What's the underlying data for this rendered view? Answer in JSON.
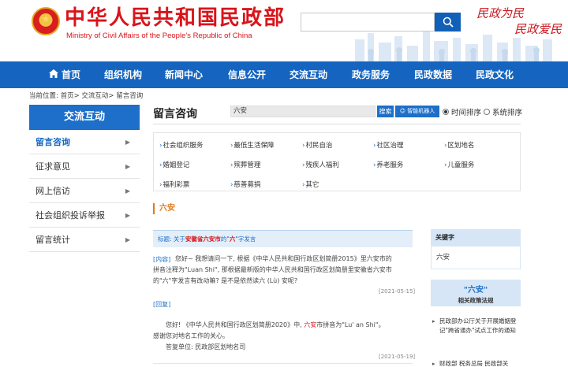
{
  "header": {
    "title": "中华人民共和国民政部",
    "subtitle": "Ministry of Civil Affairs of the People's Republic of China",
    "search_placeholder": "",
    "slogan_line1": "民政为民",
    "slogan_line2": "民政爱民"
  },
  "nav": {
    "items": [
      "首页",
      "组织机构",
      "新闻中心",
      "信息公开",
      "交流互动",
      "政务服务",
      "民政数据",
      "民政文化"
    ]
  },
  "breadcrumb": "当前位置: 首页> 交流互动> 留言咨询",
  "sidebar": {
    "heading": "交流互动",
    "items": [
      {
        "label": "留言咨询",
        "active": true
      },
      {
        "label": "征求意见",
        "active": false
      },
      {
        "label": "网上信访",
        "active": false
      },
      {
        "label": "社会组织投诉举报",
        "active": false
      },
      {
        "label": "留言统计",
        "active": false
      }
    ]
  },
  "main": {
    "title": "留言咨询",
    "search_value": "六安",
    "search_button": "搜索",
    "robot_button": "智能机器人",
    "sort_time": "时间排序",
    "sort_system": "系统排序",
    "sort_selected": "时间排序",
    "categories": [
      "社会组织服务",
      "最低生活保障",
      "村民自治",
      "社区治理",
      "区划地名",
      "婚姻登记",
      "殡葬管理",
      "残疾人福利",
      "养老服务",
      "儿童服务",
      "福利彩票",
      "慈善募捐",
      "其它"
    ],
    "keyword_heading": "六安"
  },
  "message": {
    "title_prefix": "标题: 关于",
    "title_hl1": "安徽省六安市",
    "title_mid": "的\"",
    "title_hl2": "六",
    "title_suffix": "\"字发言",
    "inquiry_tag": "[内容]",
    "inquiry_line1": "您好~ 我想请问一下, 根据《中华人民共和国行政区划简册2015》里六安市的",
    "inquiry_line2": "拼音注释为\"Luan Shi\", 那根据最新版的中华人民共和国行政区划简册里安徽省六安市",
    "inquiry_line3": "的\"六\"字发言有改动嘛? 是不是依然读六 (Lù) 安呢?",
    "inquiry_date": "[2021-05-15]",
    "reply_tag": "[回复]",
    "reply_line1_a": "您好! 《中华人民共和国行政区划简册2020》中, ",
    "reply_line1_hl": "六安",
    "reply_line1_b": "市拼音为\"Lu' an Shi\"。",
    "reply_line2": "感谢您对地名工作的关心。",
    "reply_line3": "答复单位: 民政部区划地名司",
    "reply_date": "[2021-05-19]"
  },
  "aside": {
    "keyword_label": "关键字",
    "keyword_value": "六安",
    "related_title": "\"六安\"",
    "related_subtitle": "相关政策法规",
    "related_items": [
      "民政部办公厅关于开展婚姻登记\"跨省通办\"试点工作的通知",
      "财政部 税务总局 民政部关"
    ]
  },
  "colors": {
    "brand_red": "#d9141a",
    "nav_blue": "#1565c0",
    "accent_blue": "#1d6fc9",
    "keyword_orange": "#e07a1a"
  }
}
